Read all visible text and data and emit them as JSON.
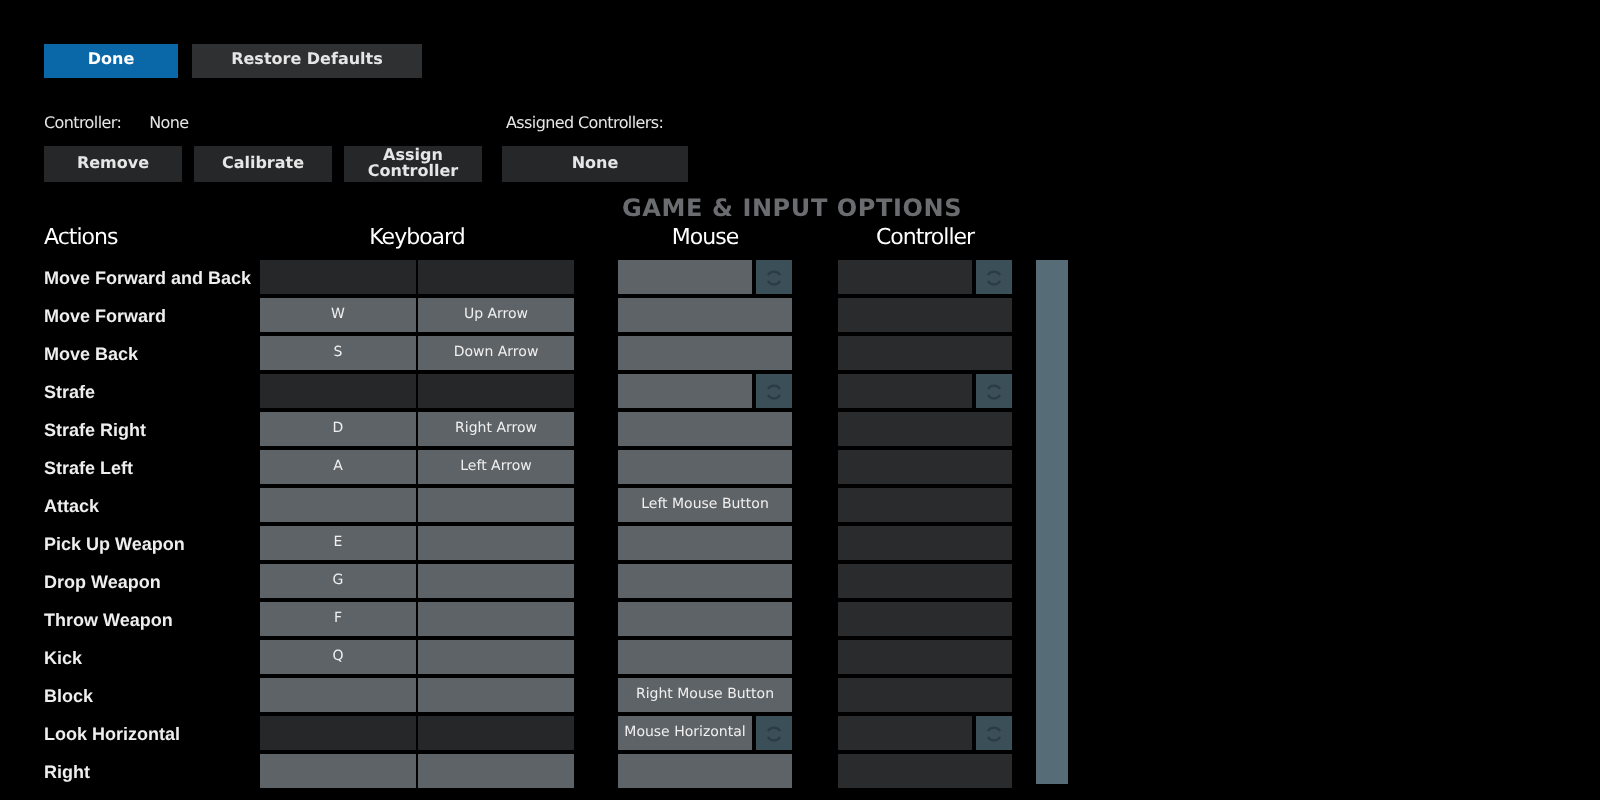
{
  "top_buttons": [
    {
      "label": "Done",
      "kind": "primary"
    },
    {
      "label": "Restore Defaults",
      "kind": "secondary"
    }
  ],
  "controller": {
    "label": "Controller:",
    "value": "None"
  },
  "assigned": {
    "label": "Assigned Controllers:"
  },
  "controller_buttons": [
    "Remove",
    "Calibrate",
    "Assign Controller"
  ],
  "assigned_button": "None",
  "background_heading": "GAME & INPUT OPTIONS",
  "columns": [
    "Actions",
    "Keyboard",
    "Mouse",
    "Controller"
  ],
  "rows": [
    {
      "action": "Move Forward and Back",
      "kind": "axis"
    },
    {
      "action": "Move Forward",
      "kind": "button",
      "key_1": "W",
      "key_2": "Up Arrow"
    },
    {
      "action": "Move Back",
      "kind": "button",
      "key_1": "S",
      "key_2": "Down Arrow"
    },
    {
      "action": "Strafe",
      "kind": "axis"
    },
    {
      "action": "Strafe Right",
      "kind": "button",
      "key_1": "D",
      "key_2": "Right Arrow"
    },
    {
      "action": "Strafe Left",
      "kind": "button",
      "key_1": "A",
      "key_2": "Left Arrow"
    },
    {
      "action": "Attack",
      "kind": "button",
      "mouse": "Left Mouse Button"
    },
    {
      "action": "Pick Up Weapon",
      "kind": "button",
      "key_1": "E"
    },
    {
      "action": "Drop Weapon",
      "kind": "button",
      "key_1": "G"
    },
    {
      "action": "Throw Weapon",
      "kind": "button",
      "key_1": "F"
    },
    {
      "action": "Kick",
      "kind": "button",
      "key_1": "Q"
    },
    {
      "action": "Block",
      "kind": "button",
      "mouse": "Right Mouse Button"
    },
    {
      "action": "Look Horizontal",
      "kind": "axis",
      "mouse": "Mouse Horizontal"
    },
    {
      "action": "Right",
      "kind": "button"
    }
  ]
}
